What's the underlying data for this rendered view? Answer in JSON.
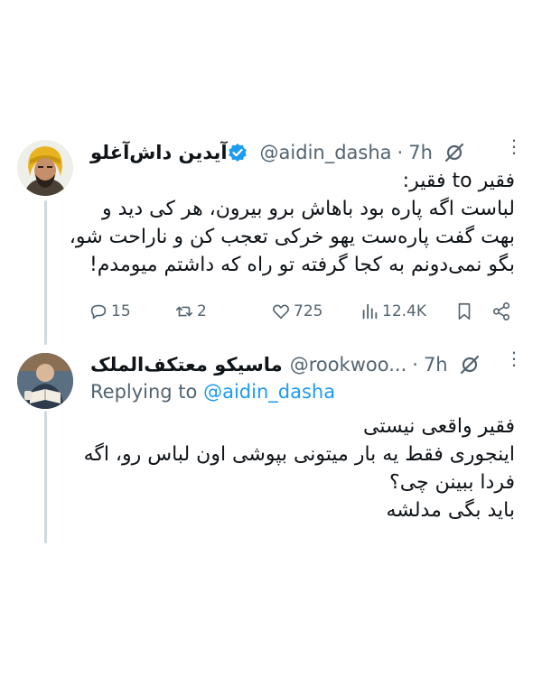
{
  "tweet1": {
    "display_name": "آیدین داش‌آغلو",
    "handle": "@aidin_dasha",
    "separator": "·",
    "time": "7h",
    "text_lines": [
      "فقیر to فقیر:",
      "لباست اگه پاره بود باهاش برو بیرون، هر کی دید و",
      "بهت گفت پاره‌ست یهو خرکی تعجب کن و ناراحت شو،",
      "بگو نمی‌دونم به کجا گرفته تو راه که داشتم میومدم!"
    ],
    "actions": {
      "replies": "15",
      "retweets": "2",
      "likes": "725",
      "views": "12.4K"
    }
  },
  "tweet2": {
    "display_name": "ماسیکو معتکف‌الملک",
    "handle": "@rookwoo...",
    "separator": "·",
    "time": "7h",
    "replying_prefix": "Replying to",
    "replying_to": "@aidin_dasha",
    "text_lines": [
      "فقیر واقعی نیستی",
      "اینجوری فقط یه بار میتونی بپوشی اون لباس رو، اگه",
      "فردا ببینن چی؟",
      "باید بگی مدلشه"
    ]
  },
  "icons": {
    "verified": "verified-badge-icon",
    "grok": "grok-icon",
    "more": "more-icon",
    "reply": "reply-icon",
    "retweet": "retweet-icon",
    "like": "like-icon",
    "views": "views-icon",
    "bookmark": "bookmark-icon",
    "share": "share-icon"
  },
  "colors": {
    "text": "#0f1419",
    "secondary": "#536471",
    "accent": "#1d9bf0",
    "thread_line": "#cfd9de"
  }
}
